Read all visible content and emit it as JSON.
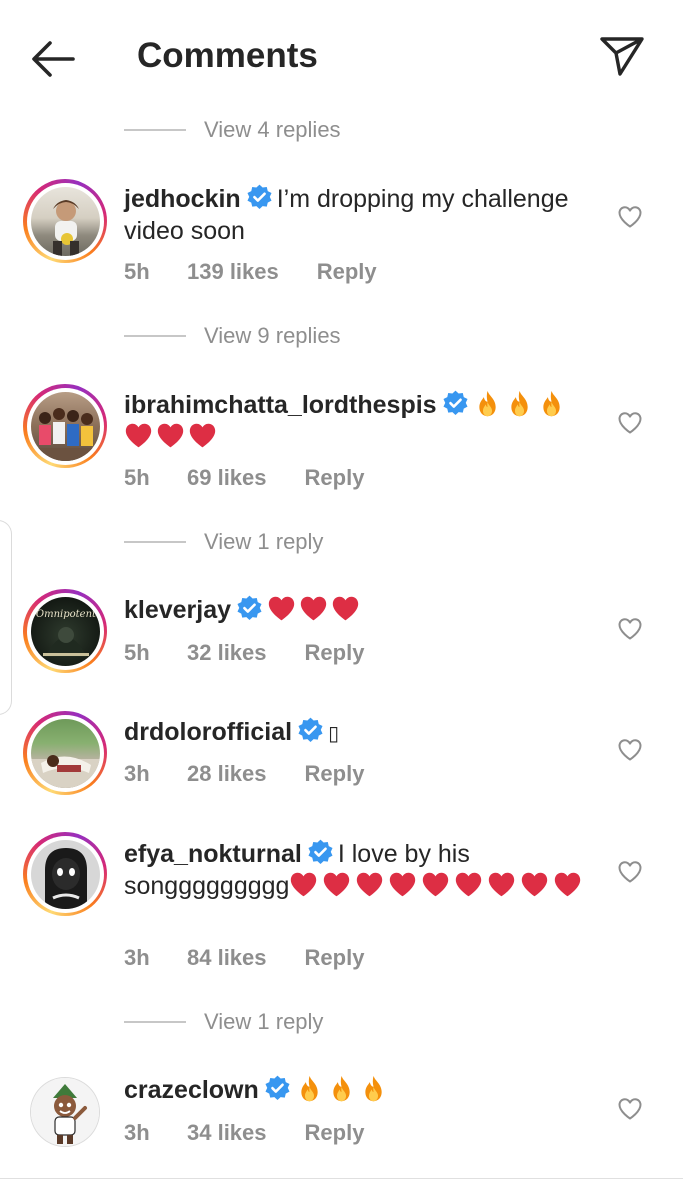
{
  "header": {
    "title": "Comments"
  },
  "view_replies": [
    {
      "label": "View 4 replies"
    },
    {
      "label": "View 9 replies"
    },
    {
      "label": "View 1 reply"
    },
    {
      "label": "View 1 reply"
    }
  ],
  "comments": [
    {
      "username": "jedhockin",
      "text": "I’m dropping my challenge video soon",
      "time": "5h",
      "likes": "139 likes",
      "reply": "Reply"
    },
    {
      "username": "ibrahimchatta_lordthespis",
      "text": "🔥🔥🔥❤️❤️❤️",
      "time": "5h",
      "likes": "69 likes",
      "reply": "Reply"
    },
    {
      "username": "kleverjay",
      "text": "❤️❤️❤️",
      "time": "5h",
      "likes": "32 likes",
      "reply": "Reply"
    },
    {
      "username": "drdolorofficial",
      "text": "▯",
      "time": "3h",
      "likes": "28 likes",
      "reply": "Reply"
    },
    {
      "username": "efya_nokturnal",
      "text": "I love by his songgggggggg❤️❤️❤️❤️❤️❤️❤️❤️❤️",
      "text_visible": "I love by his songgggggggg",
      "time": "3h",
      "likes": "84 likes",
      "reply": "Reply"
    },
    {
      "username": "crazeclown",
      "text": "🔥🔥🔥",
      "time": "3h",
      "likes": "34 likes",
      "reply": "Reply"
    }
  ],
  "icons": {
    "back": "arrow-left-icon",
    "send": "paper-plane-icon",
    "verified": "verified-badge-icon",
    "heart": "heart-outline-icon",
    "fire": "fire-emoji",
    "red_heart": "red-heart-emoji"
  },
  "colors": {
    "verified": "#3897f0",
    "muted": "#8e8e8e",
    "text": "#262626",
    "heart_red": "#e0192d"
  }
}
